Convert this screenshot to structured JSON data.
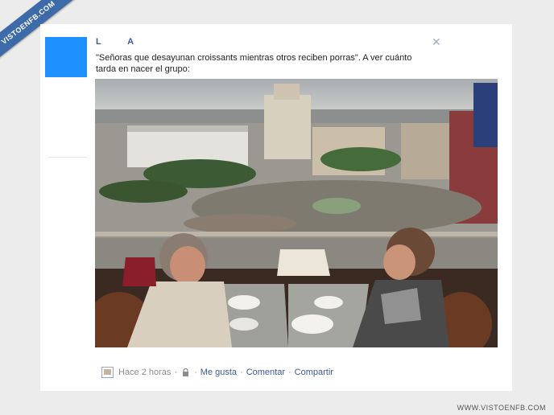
{
  "brand": {
    "ribbon_text": "VISTOENFB.COM",
    "watermark": "WWW.VISTOENFB.COM",
    "accent": "#3b5998",
    "avatar_color": "#1e90ff"
  },
  "post": {
    "author": "L A",
    "text": "\"Señoras que desayunan croissants mientras otros reciben porras\". A ver cuánto tarda en nacer el grupo:",
    "close_icon": "close-icon",
    "photo_description_icon": "photo"
  },
  "actions": {
    "time": "Hace 2 horas",
    "like": "Me gusta",
    "comment": "Comentar",
    "share": "Compartir",
    "separator": "·"
  }
}
